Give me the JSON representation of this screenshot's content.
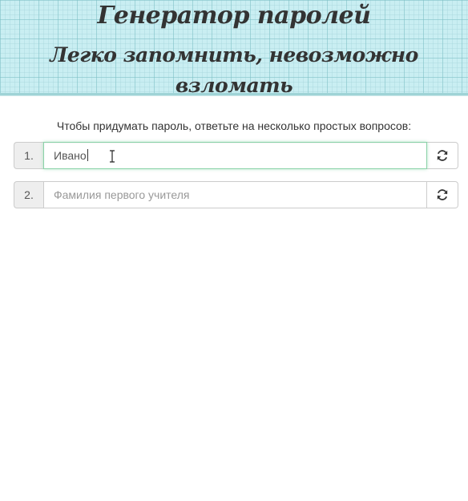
{
  "header": {
    "title": "Генератор паролей",
    "subtitle": "Легко запомнить, невозможно взломать"
  },
  "intro": "Чтобы придумать пароль, ответьте на несколько простых вопросов:",
  "questions": [
    {
      "number": "1.",
      "value": "Ивано",
      "placeholder": "",
      "refresh_icon": "refresh-icon"
    },
    {
      "number": "2.",
      "value": "",
      "placeholder": "Фамилия первого учителя",
      "refresh_icon": "refresh-icon"
    }
  ]
}
